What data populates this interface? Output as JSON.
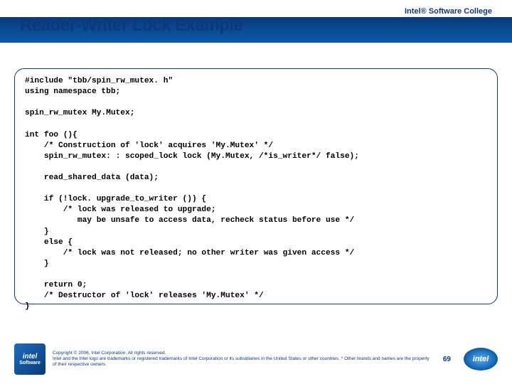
{
  "header": {
    "brand": "Intel® Software College",
    "title": "Reader-Writer Lock Example"
  },
  "code": "#include \"tbb/spin_rw_mutex. h\"\nusing namespace tbb;\n\nspin_rw_mutex My.Mutex;\n\nint foo (){\n    /* Construction of 'lock' acquires 'My.Mutex' */\n    spin_rw_mutex: : scoped_lock lock (My.Mutex, /*is_writer*/ false);\n\n    read_shared_data (data);\n\n    if (!lock. upgrade_to_writer ()) {\n        /* lock was released to upgrade;\n           may be unsafe to access data, recheck status before use */\n    }\n    else {\n        /* lock was not released; no other writer was given access */\n    }\n\n    return 0;\n    /* Destructor of 'lock' releases 'My.Mutex' */\n}",
  "footer": {
    "logo_left_top": "intel",
    "logo_left_bottom": "Software",
    "copyright_line1": "Copyright © 2006, Intel Corporation. All rights reserved.",
    "copyright_line2": "Intel and the Intel logo are trademarks or registered trademarks of Intel Corporation or its subsidiaries in the United States or other countries. * Other brands and names are the property of their respective owners.",
    "page_number": "69",
    "logo_right": "intel"
  }
}
